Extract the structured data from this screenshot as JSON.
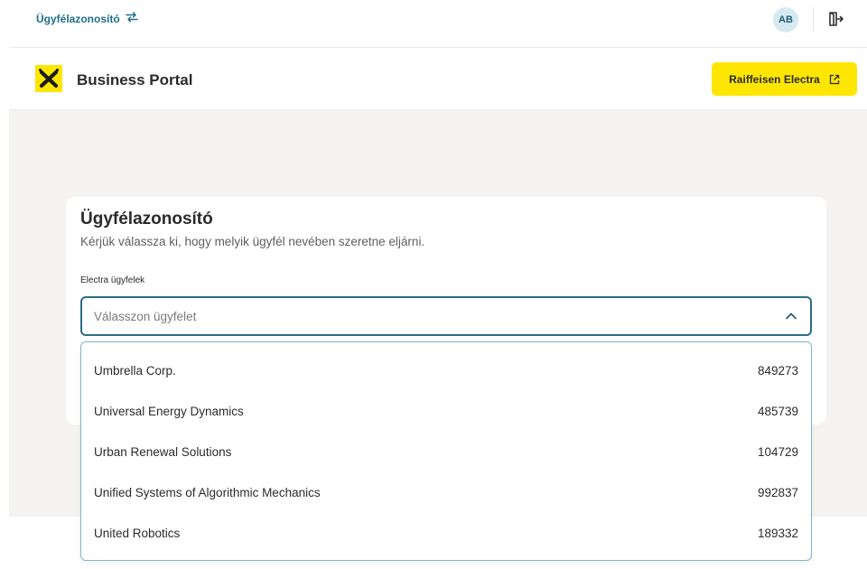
{
  "topbar": {
    "client_label": "Ügyfélazonosító",
    "avatar_initials": "AB"
  },
  "header": {
    "brand": "Business Portal",
    "electra_button": "Raiffeisen Electra"
  },
  "card": {
    "title": "Ügyfélazonosító",
    "subtitle": "Kérjük válassza ki, hogy melyik ügyfél nevében szeretne eljárni.",
    "field_label": "Electra ügyfelek",
    "select_placeholder": "Válasszon ügyfelet"
  },
  "dropdown": {
    "options": [
      {
        "name": "Umbrella Corp.",
        "id": "849273"
      },
      {
        "name": "Universal Energy Dynamics",
        "id": "485739"
      },
      {
        "name": "Urban Renewal Solutions",
        "id": "104729"
      },
      {
        "name": "Unified Systems of Algorithmic Mechanics",
        "id": "992837"
      },
      {
        "name": "United Robotics",
        "id": "189332"
      }
    ]
  },
  "colors": {
    "brand_yellow": "#fee600",
    "accent_teal": "#2a6f86",
    "link_blue": "#1f6f8b",
    "background_gray": "#f4f3f2"
  },
  "icons": [
    "swap-arrows-icon",
    "logout-door-icon",
    "raiffeisen-logo-icon",
    "external-link-icon",
    "chevron-up-icon"
  ]
}
